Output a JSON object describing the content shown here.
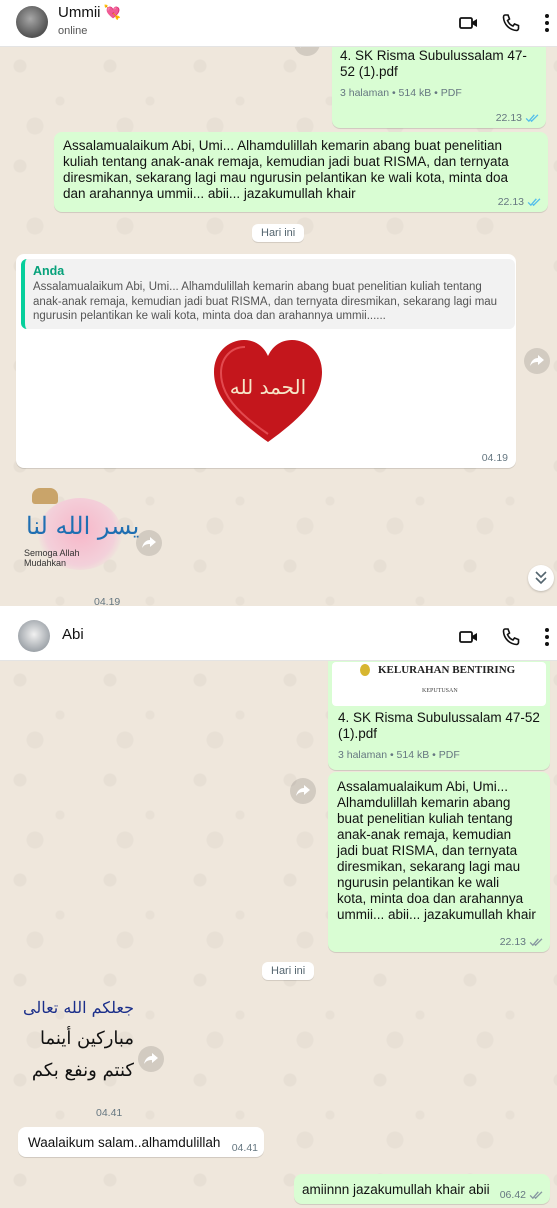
{
  "chat1": {
    "contact_name": "Ummii",
    "status": "online",
    "doc": {
      "name": "4. SK Risma Subulussalam 47-52 (1).pdf",
      "meta": "3 halaman • 514 kB • PDF",
      "time": "22.13"
    },
    "msg1": {
      "text": "Assalamualaikum Abi, Umi... Alhamdulillah kemarin abang buat penelitian kuliah tentang anak-anak remaja, kemudian jadi buat RISMA, dan ternyata diresmikan, sekarang lagi mau ngurusin pelantikan ke wali kota, minta doa dan arahannya ummii... abii... jazakumullah khair",
      "time": "22.13"
    },
    "date_label": "Hari ini",
    "reply": {
      "author": "Anda",
      "quote": "Assalamualaikum Abi, Umi... Alhamdulillah kemarin abang buat penelitian kuliah tentang anak-anak remaja, kemudian jadi buat RISMA, dan ternyata diresmikan, sekarang lagi mau ngurusin pelantikan ke wali kota, minta doa dan arahannya ummii......",
      "heart_text": "الحمد لله",
      "time": "04.19"
    },
    "sticker": {
      "arabic": "يسر الله لنا",
      "caption_line1": "Semoga Allah",
      "caption_line2": "Mudahkan",
      "time": "04.19"
    }
  },
  "chat2": {
    "contact_name": "Abi",
    "doc_preview": {
      "line1": "KELURAHAN BENTIRING",
      "line2": "KEPUTUSAN"
    },
    "doc": {
      "name": "4. SK Risma Subulussalam 47-52 (1).pdf",
      "meta": "3 halaman • 514 kB • PDF"
    },
    "msg1": {
      "lines": [
        "Assalamualaikum Abi, Umi...",
        "Alhamdulillah kemarin abang",
        "buat penelitian kuliah tentang",
        "anak-anak remaja, kemudian",
        "jadi buat RISMA, dan ternyata",
        "diresmikan, sekarang lagi mau",
        "ngurusin pelantikan ke wali",
        "kota, minta doa dan arahannya",
        "ummii... abii... jazakumullah khair"
      ],
      "time": "22.13"
    },
    "date_label": "Hari ini",
    "sticker": {
      "line1": "جعلكم الله تعالى",
      "line2": "مباركين أينما",
      "line3": "كنتم ونفع بكم",
      "time": "04.41"
    },
    "reply_in": {
      "text": "Waalaikum salam..alhamdulillah",
      "time": "04.41"
    },
    "reply_out": {
      "text": "amiinnn jazakumullah khair abii",
      "time": "06.42"
    }
  },
  "colors": {
    "outgoing": "#d9fdd3",
    "incoming": "#ffffff",
    "wallpaper": "#efe7dc",
    "read_tick": "#53bdeb",
    "reply_bar": "#06cf9c"
  }
}
